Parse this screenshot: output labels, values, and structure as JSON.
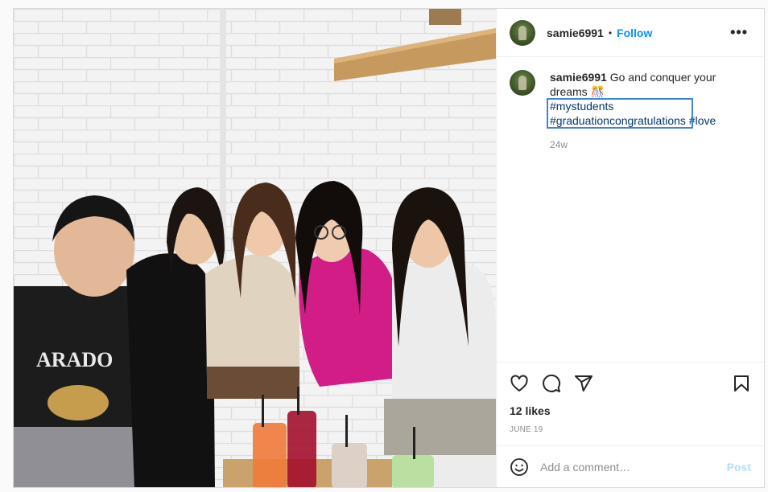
{
  "header": {
    "username": "samie6991",
    "separator": "•",
    "follow_label": "Follow",
    "more_label": "•••"
  },
  "caption": {
    "username": "samie6991",
    "text": "Go and conquer your dreams 🎊",
    "tags": [
      "#mystudents",
      "#graduationcongratulations",
      "#love"
    ],
    "time": "24w"
  },
  "actions": {
    "icons": [
      "heart-icon",
      "comment-icon",
      "share-icon",
      "bookmark-icon"
    ],
    "likes": "12 likes",
    "date": "JUNE 19"
  },
  "comment_box": {
    "placeholder": "Add a comment…",
    "post_label": "Post"
  },
  "colors": {
    "link": "#0095f6",
    "hashtag": "#00376b",
    "highlight_box": "#3d86d9",
    "muted": "#8e8e8e",
    "post_disabled": "#b2dffc"
  }
}
